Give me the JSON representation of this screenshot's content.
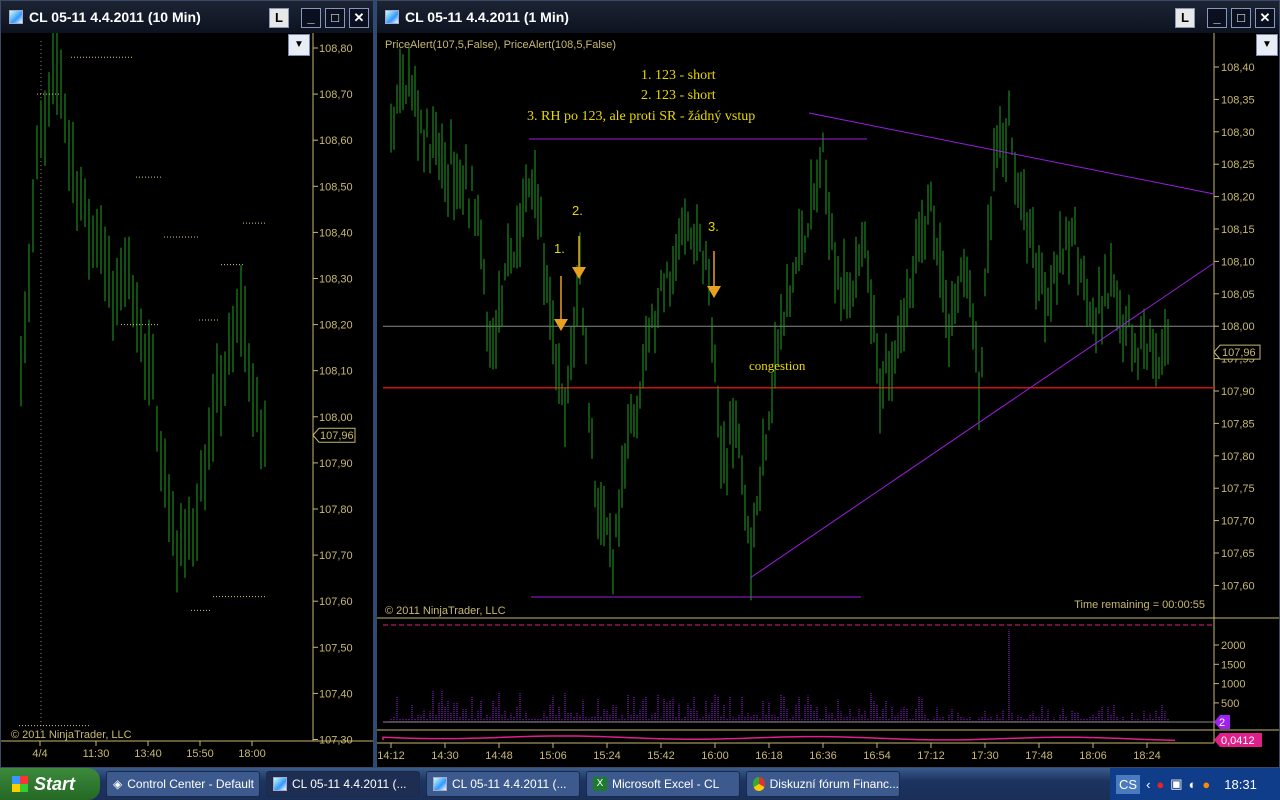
{
  "left_window": {
    "title": "CL 05-11  4.4.2011 (10 Min)",
    "lock_label": "L",
    "copyright": "© 2011 NinjaTrader, LLC",
    "price_labels": [
      "108,80",
      "108,70",
      "108,60",
      "108,50",
      "108,40",
      "108,30",
      "108,20",
      "108,10",
      "108,00",
      "107,90",
      "107,80",
      "107,70",
      "107,60",
      "107,50",
      "107,40",
      "107,30"
    ],
    "last_price": "107,96",
    "time_labels": [
      "4/4",
      "11:30",
      "13:40",
      "15:50",
      "18:00"
    ],
    "price_path": [
      108.12,
      108.3,
      108.55,
      108.62,
      108.72,
      108.76,
      108.6,
      108.52,
      108.45,
      108.38,
      108.42,
      108.3,
      108.22,
      108.35,
      108.3,
      108.2,
      108.1,
      108.05,
      107.9,
      107.78,
      107.7,
      107.72,
      107.78,
      107.85,
      107.92,
      108.05,
      108.1,
      108.15,
      108.25,
      108.1,
      107.98,
      107.96
    ]
  },
  "right_window": {
    "title": "CL 05-11  4.4.2011 (1 Min)",
    "lock_label": "L",
    "indicator_label": "PriceAlert(107,5,False), PriceAlert(108,5,False)",
    "annotations": [
      "1. 123 - short",
      "2. 123 - short",
      "3. RH po 123, ale proti SR - žádný vstup"
    ],
    "arrow_labels": [
      "1.",
      "2.",
      "3."
    ],
    "congestion_label": "congestion",
    "copyright": "© 2011 NinjaTrader, LLC",
    "time_remaining": "Time remaining = 00:00:55",
    "price_labels": [
      "108,40",
      "108,35",
      "108,30",
      "108,25",
      "108,20",
      "108,15",
      "108,10",
      "108,05",
      "108,00",
      "107,95",
      "107,90",
      "107,85",
      "107,80",
      "107,75",
      "107,70",
      "107,65",
      "107,60"
    ],
    "last_price": "107,96",
    "volume_labels": [
      "2000",
      "1500",
      "1000",
      "500"
    ],
    "volume_last": "2",
    "indicator_last": "0,0412",
    "time_labels": [
      "14:12",
      "14:30",
      "14:48",
      "15:06",
      "15:24",
      "15:42",
      "16:00",
      "16:18",
      "16:36",
      "16:54",
      "17:12",
      "17:30",
      "17:48",
      "18:06",
      "18:24"
    ],
    "alert_levels": [
      108.0,
      107.905
    ],
    "colors": {
      "bars": "#1fa01f",
      "alert_gray": "#888888",
      "alert_red": "#d01010",
      "trend": "#9a1ee0",
      "arrow": "#e8a020",
      "text": "#e8d800",
      "axis": "#c8b870",
      "volume": "#a020f0",
      "indicator": "#e0208a"
    }
  },
  "chart_data": {
    "type": "bar",
    "title": "CL 05-11 4.4.2011 (1 Min)",
    "ylim": [
      107.57,
      108.43
    ],
    "key_points_minutes_from_1412": [
      0,
      5,
      13,
      28,
      33,
      40,
      48,
      53,
      58,
      63,
      68,
      74,
      80,
      88,
      98,
      105,
      110,
      116,
      120,
      128,
      138,
      144,
      150,
      158,
      163,
      173,
      180,
      186,
      192,
      196,
      201,
      206,
      212,
      218,
      228,
      234,
      240,
      248,
      259
    ],
    "key_points_price": [
      108.3,
      108.38,
      108.28,
      108.2,
      107.95,
      108.1,
      108.25,
      108.0,
      107.85,
      108.1,
      107.75,
      107.62,
      107.85,
      108.02,
      108.15,
      108.1,
      107.8,
      107.85,
      107.65,
      107.95,
      108.15,
      108.25,
      108.05,
      108.1,
      107.9,
      108.05,
      108.2,
      108.0,
      108.1,
      107.9,
      108.25,
      108.3,
      108.15,
      108.05,
      108.15,
      108.0,
      108.05,
      107.98,
      107.96
    ],
    "volume_max": 2400
  },
  "taskbar": {
    "start_label": "Start",
    "items": [
      "Control Center - Default",
      "CL 05-11  4.4.2011 (...",
      "CL 05-11  4.4.2011 (...",
      "Microsoft Excel - CL",
      "Diskuzní fórum Financ..."
    ],
    "lang": "CS",
    "clock": "18:31"
  }
}
